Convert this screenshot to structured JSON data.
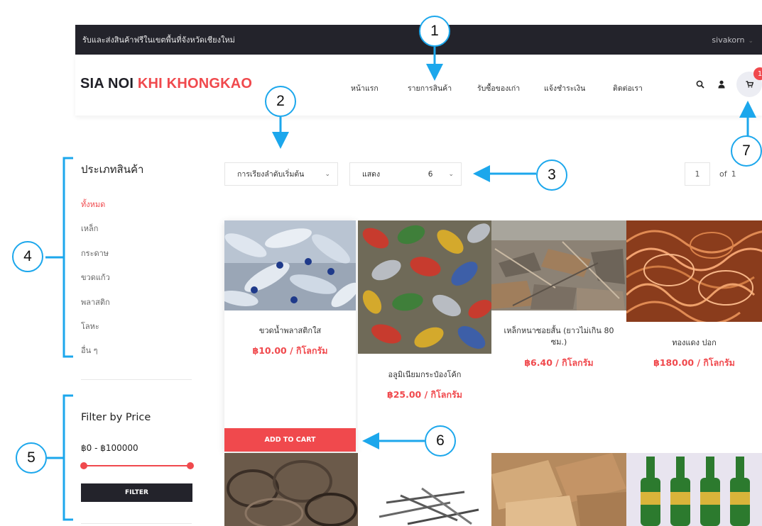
{
  "topbar": {
    "promo": "รับและส่งสินค้าฟรีในเขตพื้นที่จังหวัดเชียงใหม่",
    "user": "sivakorn"
  },
  "header": {
    "logo_main": "SIA NOI ",
    "logo_accent": "KHI KHONGKAO",
    "nav": [
      "หน้าแรก",
      "รายการสินค้า",
      "รับซื้อของเก่า",
      "แจ้งชำระเงิน",
      "ติดต่อเรา"
    ],
    "cart_count": "1"
  },
  "sidebar": {
    "category_title": "ประเภทสินค้า",
    "categories": [
      "ทั้งหมด",
      "เหล็ก",
      "กระดาษ",
      "ขวดแก้ว",
      "พลาสติก",
      "โลหะ",
      "อื่น ๆ"
    ],
    "price_title": "Filter by Price",
    "price_range": "฿0 - ฿100000",
    "filter_label": "FILTER"
  },
  "toolbar": {
    "sort_label": "การเรียงลำดับเริ่มต้น",
    "show_label": "แสดง",
    "show_value": "6",
    "page_current": "1",
    "page_of": "of",
    "page_total": "1"
  },
  "products": [
    {
      "name": "ขวดน้ำพลาสติกใส",
      "price": "฿10.00 / กิโลกรัม"
    },
    {
      "name": "อลูมิเนียมกระป๋องโค้ก",
      "price": "฿25.00 / กิโลกรัม"
    },
    {
      "name": "เหล็กหนาซอยสั้น (ยาวไม่เกิน 80 ซม.)",
      "price": "฿6.40 / กิโลกรัม"
    },
    {
      "name": "ทองแดง ปอก",
      "price": "฿180.00 / กิโลกรัม"
    }
  ],
  "add_to_cart": "ADD TO CART",
  "annotations": [
    "1",
    "2",
    "3",
    "4",
    "5",
    "6",
    "7"
  ],
  "colors": {
    "accent": "#f0494d",
    "dark": "#23232b",
    "annotation": "#1ca7ec"
  }
}
